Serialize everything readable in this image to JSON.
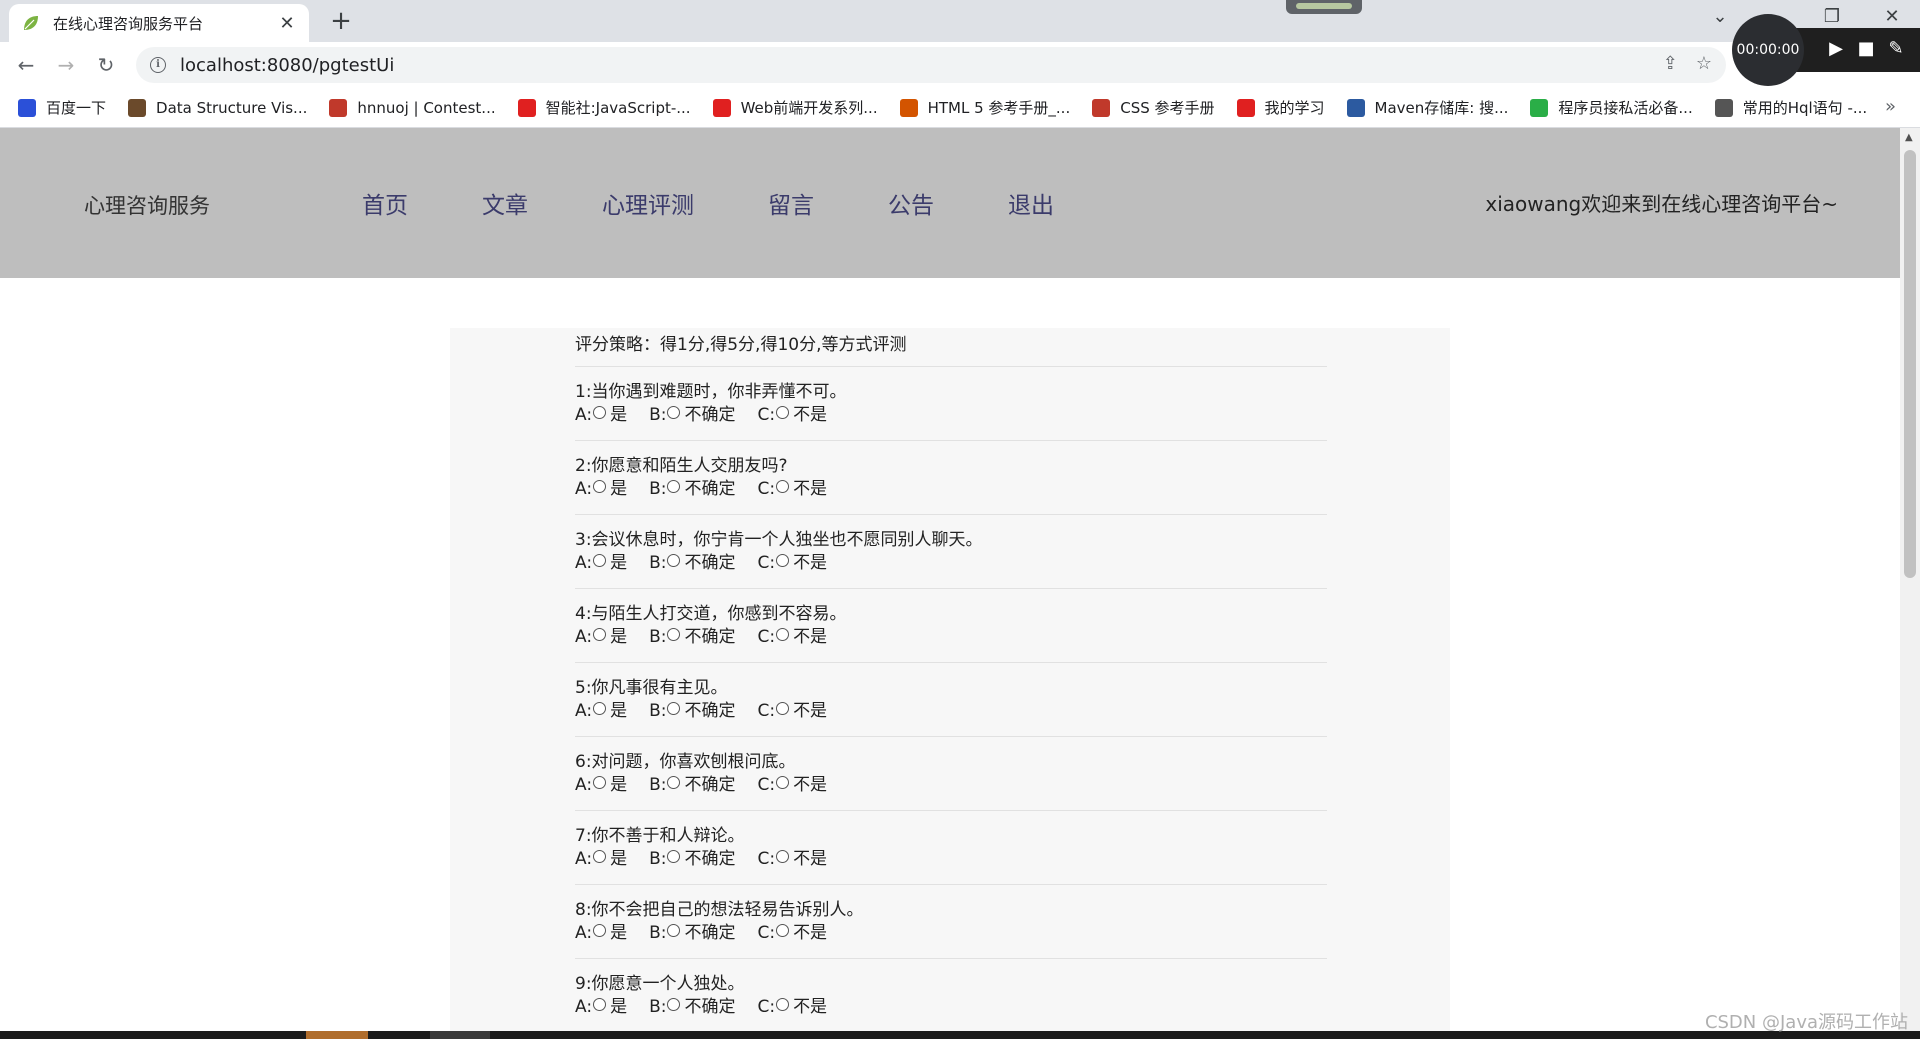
{
  "browser": {
    "tab_title": "在线心理咨询服务平台",
    "tab_close": "✕",
    "new_tab": "+",
    "url": "localhost:8080/pgtestUi",
    "window_controls": [
      "⌄",
      "❐",
      "✕"
    ],
    "recorder_time": "00:00:00",
    "bookmarks": [
      {
        "label": "百度一下",
        "icon": "paw-icon",
        "color": "#2b50d8"
      },
      {
        "label": "Data Structure Vis...",
        "icon": "image-icon",
        "color": "#6b4a2b"
      },
      {
        "label": "hnnuoj | Contest...",
        "icon": "balloon-icon",
        "color": "#c0392b"
      },
      {
        "label": "智能社:JavaScript-...",
        "icon": "bookmark-red-icon",
        "color": "#e02020"
      },
      {
        "label": "Web前端开发系列...",
        "icon": "bookmark-red-icon",
        "color": "#e02020"
      },
      {
        "label": "HTML 5 参考手册_...",
        "icon": "html-icon",
        "color": "#d35400"
      },
      {
        "label": "CSS 参考手册",
        "icon": "css-icon",
        "color": "#c0392b"
      },
      {
        "label": "我的学习",
        "icon": "bookmark-red-icon",
        "color": "#e02020"
      },
      {
        "label": "Maven存储库: 搜...",
        "icon": "maven-icon",
        "color": "#2c5aa0"
      },
      {
        "label": "程序员接私活必备...",
        "icon": "wechat-icon",
        "color": "#2aae47"
      },
      {
        "label": "常用的Hql语句 -...",
        "icon": "link-icon",
        "color": "#555555"
      }
    ],
    "bookmarks_more": "»"
  },
  "site": {
    "brand": "心理咨询服务",
    "nav": [
      "首页",
      "文章",
      "心理评测",
      "留言",
      "公告",
      "退出"
    ],
    "welcome": "xiaowang欢迎来到在线心理咨询平台~"
  },
  "survey": {
    "strategy": "评分策略：得1分,得5分,得10分,等方式评测",
    "option_labels": [
      {
        "prefix": "A:",
        "text": "是"
      },
      {
        "prefix": "B:",
        "text": "不确定"
      },
      {
        "prefix": "C:",
        "text": "不是"
      }
    ],
    "questions": [
      "1:当你遇到难题时，你非弄懂不可。",
      "2:你愿意和陌生人交朋友吗?",
      "3:会议休息时，你宁肯一个人独坐也不愿同别人聊天。",
      "4:与陌生人打交道，你感到不容易。",
      "5:你凡事很有主见。",
      "6:对问题，你喜欢刨根问底。",
      "7:你不善于和人辩论。",
      "8:你不会把自己的想法轻易告诉别人。",
      "9:你愿意一个人独处。"
    ]
  },
  "watermark": "CSDN @Java源码工作站"
}
